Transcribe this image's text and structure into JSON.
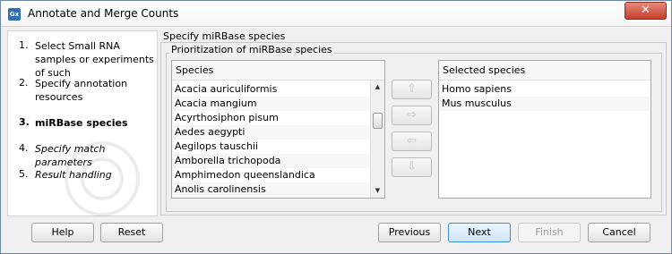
{
  "window": {
    "title": "Annotate and Merge Counts",
    "app_icon": "Gx",
    "close_glyph": "✕"
  },
  "steps": [
    {
      "num": "1.",
      "label": "Select Small RNA samples or experiments of such",
      "state": "done"
    },
    {
      "num": "2.",
      "label": "Specify annotation resources",
      "state": "done"
    },
    {
      "num": "3.",
      "label": "miRBase species",
      "state": "current"
    },
    {
      "num": "4.",
      "label": "Specify match parameters",
      "state": "future"
    },
    {
      "num": "5.",
      "label": "Result handling",
      "state": "future"
    }
  ],
  "main": {
    "section_label": "Specify miRBase species",
    "group_title": "Prioritization of miRBase species",
    "species_list": {
      "header": "Species",
      "items": [
        "Acacia auriculiformis",
        "Acacia mangium",
        "Acyrthosiphon pisum",
        "Aedes aegypti",
        "Aegilops tauschii",
        "Amborella trichopoda",
        "Amphimedon queenslandica",
        "Anolis carolinensis"
      ]
    },
    "selected_list": {
      "header": "Selected species",
      "items": [
        "Homo sapiens",
        "Mus musculus"
      ]
    },
    "move_buttons": [
      {
        "name": "move-up-button",
        "glyph": "⇧"
      },
      {
        "name": "add-button",
        "glyph": "⇨"
      },
      {
        "name": "remove-button",
        "glyph": "⇦"
      },
      {
        "name": "move-down-button",
        "glyph": "⇩"
      }
    ]
  },
  "footer": {
    "help": "Help",
    "reset": "Reset",
    "previous": "Previous",
    "next": "Next",
    "finish": "Finish",
    "cancel": "Cancel"
  }
}
